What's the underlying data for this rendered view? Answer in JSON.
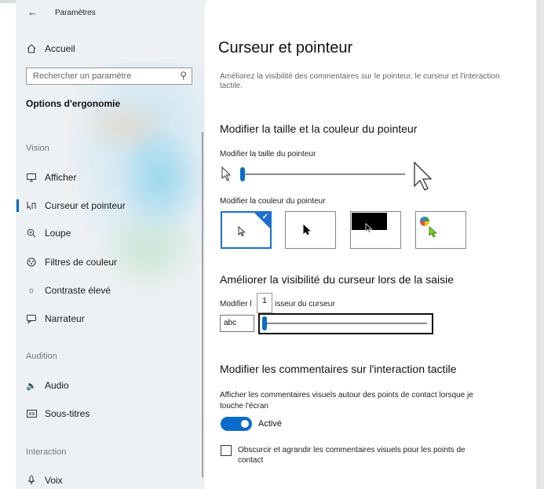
{
  "window": {
    "title": "Paramètres",
    "back_icon": "arrow-left-icon"
  },
  "sidebar": {
    "home": {
      "icon": "home-icon",
      "label": "Accueil"
    },
    "search": {
      "placeholder": "Rechercher un paramètre",
      "icon": "search-icon"
    },
    "section_title": "Options d'ergonomie",
    "groups": [
      {
        "title": "Vision",
        "items": [
          {
            "icon": "monitor-icon",
            "label": "Afficher"
          },
          {
            "icon": "cursor-pointer-icon",
            "label": "Curseur et pointeur",
            "active": true
          },
          {
            "icon": "magnifier-icon",
            "label": "Loupe"
          },
          {
            "icon": "color-filter-icon",
            "label": "Filtres de couleur"
          },
          {
            "icon": "brightness-icon",
            "label": "Contraste élevé"
          },
          {
            "icon": "narrator-icon",
            "label": "Narrateur"
          }
        ]
      },
      {
        "title": "Audition",
        "items": [
          {
            "icon": "speaker-icon",
            "label": "Audio"
          },
          {
            "icon": "captions-icon",
            "label": "Sous-titres"
          }
        ]
      },
      {
        "title": "Interaction",
        "items": [
          {
            "icon": "microphone-icon",
            "label": "Voix"
          }
        ]
      }
    ]
  },
  "main": {
    "title": "Curseur et pointeur",
    "description": "Améliorez la visibilité des commentaires sur le pointeur, le curseur et l'interaction tactile.",
    "pointer_section": {
      "heading": "Modifier la taille et la couleur du pointeur",
      "size_label": "Modifier la taille du pointeur",
      "size_value": 1,
      "color_label": "Modifier la couleur du pointeur",
      "color_options": [
        "white",
        "black",
        "inverted",
        "custom"
      ],
      "selected_color": "white",
      "accent": "#1a6fd1"
    },
    "cursor_section": {
      "heading": "Améliorer la visibilité du curseur lors de la saisie",
      "thickness_label_left": "Modifier l",
      "thickness_label_right": "isseur du curseur",
      "tooltip_value": "1",
      "preview_text": "abc"
    },
    "touch_section": {
      "heading": "Modifier les commentaires sur l'interaction tactile",
      "show_feedback_label": "Afficher les commentaires visuels autour des points de contact lorsque je touche l'écran",
      "toggle_state": "Activé",
      "toggle_on": true,
      "darken_label": "Obscurcir et agrandir les commentaires visuels pour les points de contact",
      "darken_checked": false
    }
  }
}
